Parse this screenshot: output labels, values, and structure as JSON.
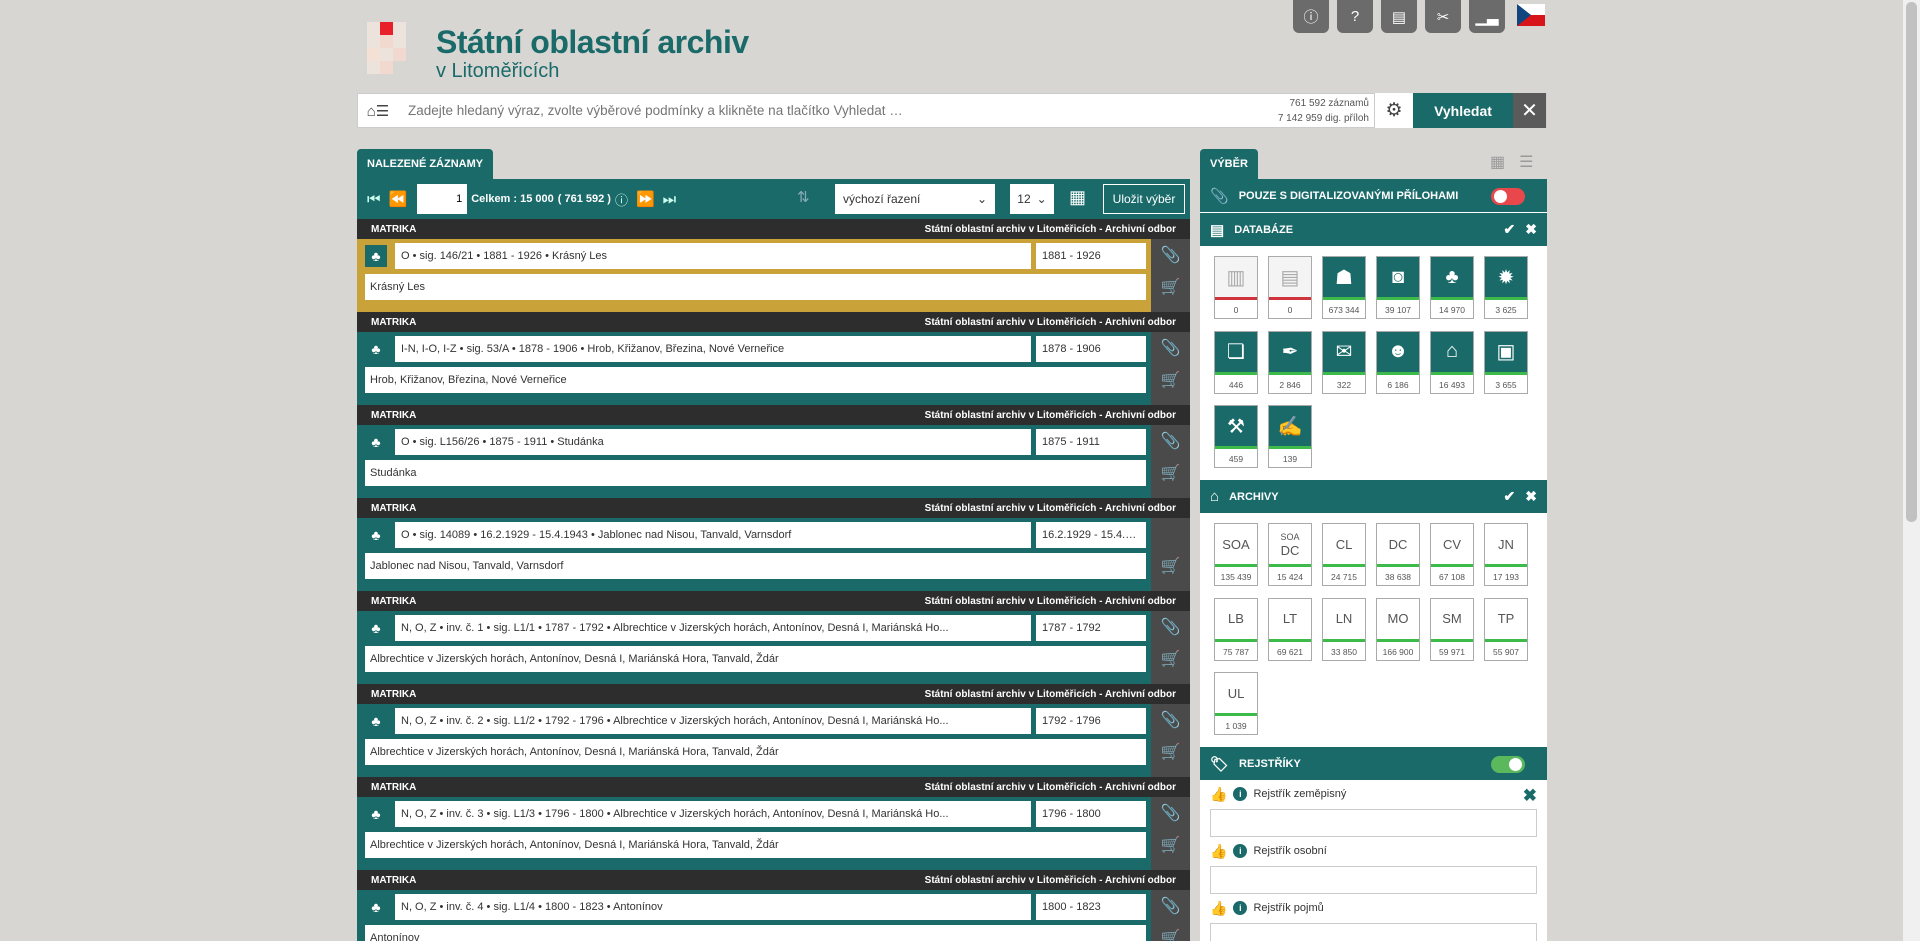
{
  "header": {
    "title": "Státní oblastní archiv",
    "subtitle": "v Litoměřicích",
    "top_icons": [
      "info-icon",
      "help-icon",
      "print-icon",
      "tools-icon",
      "stats-icon"
    ]
  },
  "search": {
    "placeholder": "Zadejte hledaný výraz, zvolte výběrové podmínky a klikněte na tlačítko Vyhledat …",
    "records_count": "761 592 záznamů",
    "attachments_count": "7 142 959 dig. příloh",
    "search_label": "Vyhledat",
    "clear_label": "✕"
  },
  "results": {
    "tab_label": "NALEZENÉ ZÁZNAMY",
    "page": "1",
    "total_label": "Celkem : 15 000",
    "total_extra": "( 761 592 )",
    "sort": "výchozí řazení",
    "per_page": "12",
    "save_label": "Uložit výběr"
  },
  "records": [
    {
      "type": "MATRIKA",
      "archive": "Státní oblastní archiv v Litoměřicích - Archivní odbor",
      "desc": "O • sig. 146/21 • 1881 - 1926 • Krásný Les",
      "dates": "1881 - 1926",
      "place": "Krásný Les",
      "attach": true
    },
    {
      "type": "MATRIKA",
      "archive": "Státní oblastní archiv v Litoměřicích - Archivní odbor",
      "desc": "I-N, I-O, I-Z • sig. 53/A • 1878 - 1906 • Hrob, Křižanov, Březina, Nové Verneřice",
      "dates": "1878 - 1906",
      "place": "Hrob, Křižanov, Březina, Nové Verneřice",
      "attach": true
    },
    {
      "type": "MATRIKA",
      "archive": "Státní oblastní archiv v Litoměřicích - Archivní odbor",
      "desc": "O • sig. L156/26 • 1875 - 1911 • Studánka",
      "dates": "1875 - 1911",
      "place": "Studánka",
      "attach": true
    },
    {
      "type": "MATRIKA",
      "archive": "Státní oblastní archiv v Litoměřicích - Archivní odbor",
      "desc": "O • sig. 14089 • 16.2.1929 - 15.4.1943 • Jablonec nad Nisou, Tanvald, Varnsdorf",
      "dates": "16.2.1929 - 15.4.1...",
      "place": "Jablonec nad Nisou, Tanvald, Varnsdorf",
      "attach": false
    },
    {
      "type": "MATRIKA",
      "archive": "Státní oblastní archiv v Litoměřicích - Archivní odbor",
      "desc": "N, O, Z • inv. č. 1 • sig. L1/1 • 1787 - 1792 • Albrechtice v Jizerských horách, Antonínov, Desná I, Mariánská Ho...",
      "dates": "1787 - 1792",
      "place": "Albrechtice v Jizerských horách, Antonínov, Desná I, Mariánská Hora, Tanvald, Ždár",
      "attach": true
    },
    {
      "type": "MATRIKA",
      "archive": "Státní oblastní archiv v Litoměřicích - Archivní odbor",
      "desc": "N, O, Z • inv. č. 2 • sig. L1/2 • 1792 - 1796 • Albrechtice v Jizerských horách, Antonínov, Desná I, Mariánská Ho...",
      "dates": "1792 - 1796",
      "place": "Albrechtice v Jizerských horách, Antonínov, Desná I, Mariánská Hora, Tanvald, Ždár",
      "attach": true
    },
    {
      "type": "MATRIKA",
      "archive": "Státní oblastní archiv v Litoměřicích - Archivní odbor",
      "desc": "N, O, Z • inv. č. 3 • sig. L1/3 • 1796 - 1800 • Albrechtice v Jizerských horách, Antonínov, Desná I, Mariánská Ho...",
      "dates": "1796 - 1800",
      "place": "Albrechtice v Jizerských horách, Antonínov, Desná I, Mariánská Hora, Tanvald, Ždár",
      "attach": true
    },
    {
      "type": "MATRIKA",
      "archive": "Státní oblastní archiv v Litoměřicích - Archivní odbor",
      "desc": "N, O, Z • inv. č. 4 • sig. L1/4 • 1800 - 1823 • Antonínov",
      "dates": "1800 - 1823",
      "place": "Antonínov",
      "attach": true
    }
  ],
  "selection": {
    "tab_label": "VÝBĚR",
    "digital_only": "POUZE S DIGITALIZOVANÝMI PŘÍLOHAMI",
    "databases_label": "DATABÁZE",
    "databases": [
      {
        "icon": "archive-boxes-icon",
        "glyph": "▥",
        "count": "0",
        "status": "inactive"
      },
      {
        "icon": "document-icon",
        "glyph": "▤",
        "count": "0",
        "status": "inactive"
      },
      {
        "icon": "reader-icon",
        "glyph": "☗",
        "count": "673 344",
        "status": "active"
      },
      {
        "icon": "camera-icon",
        "glyph": "◙",
        "count": "39 107",
        "status": "active"
      },
      {
        "icon": "tree-icon",
        "glyph": "♣",
        "count": "14 970",
        "status": "active"
      },
      {
        "icon": "seal-icon",
        "glyph": "✹",
        "count": "3 625",
        "status": "active"
      },
      {
        "icon": "scroll-icon",
        "glyph": "❏",
        "count": "446",
        "status": "active"
      },
      {
        "icon": "quill-icon",
        "glyph": "✒",
        "count": "2 846",
        "status": "active"
      },
      {
        "icon": "envelope-icon",
        "glyph": "✉",
        "count": "322",
        "status": "active"
      },
      {
        "icon": "person-icon",
        "glyph": "☻",
        "count": "6 186",
        "status": "active"
      },
      {
        "icon": "building-icon",
        "glyph": "⌂",
        "count": "16 493",
        "status": "active"
      },
      {
        "icon": "id-card-icon",
        "glyph": "▣",
        "count": "3 655",
        "status": "active"
      },
      {
        "icon": "factory-icon",
        "glyph": "⚒",
        "count": "459",
        "status": "active"
      },
      {
        "icon": "signature-icon",
        "glyph": "✍",
        "count": "139",
        "status": "active"
      }
    ],
    "archives_label": "ARCHIVY",
    "archives": [
      {
        "code": "SOA",
        "count": "135 439"
      },
      {
        "code": "SOA",
        "code2": "DC",
        "count": "15 424"
      },
      {
        "code": "CL",
        "count": "24 715"
      },
      {
        "code": "DC",
        "count": "38 638"
      },
      {
        "code": "CV",
        "count": "67 108"
      },
      {
        "code": "JN",
        "count": "17 193"
      },
      {
        "code": "LB",
        "count": "75 787"
      },
      {
        "code": "LT",
        "count": "69 621"
      },
      {
        "code": "LN",
        "count": "33 850"
      },
      {
        "code": "MO",
        "count": "166 900"
      },
      {
        "code": "SM",
        "count": "59 971"
      },
      {
        "code": "TP",
        "count": "55 907"
      },
      {
        "code": "UL",
        "count": "1 039"
      }
    ],
    "registers_label": "REJSTŘÍKY",
    "registers": [
      "Rejstřík zeměpisný",
      "Rejstřík osobní",
      "Rejstřík pojmů"
    ]
  },
  "colors": {
    "teal": "#1a6a6a",
    "gold": "#c9a33a",
    "dark": "#2d2d2d",
    "toggle_off": "#e8474c",
    "toggle_on": "#5cb85c",
    "status_active": "#3dbb4a",
    "status_inactive": "#d0343c"
  }
}
